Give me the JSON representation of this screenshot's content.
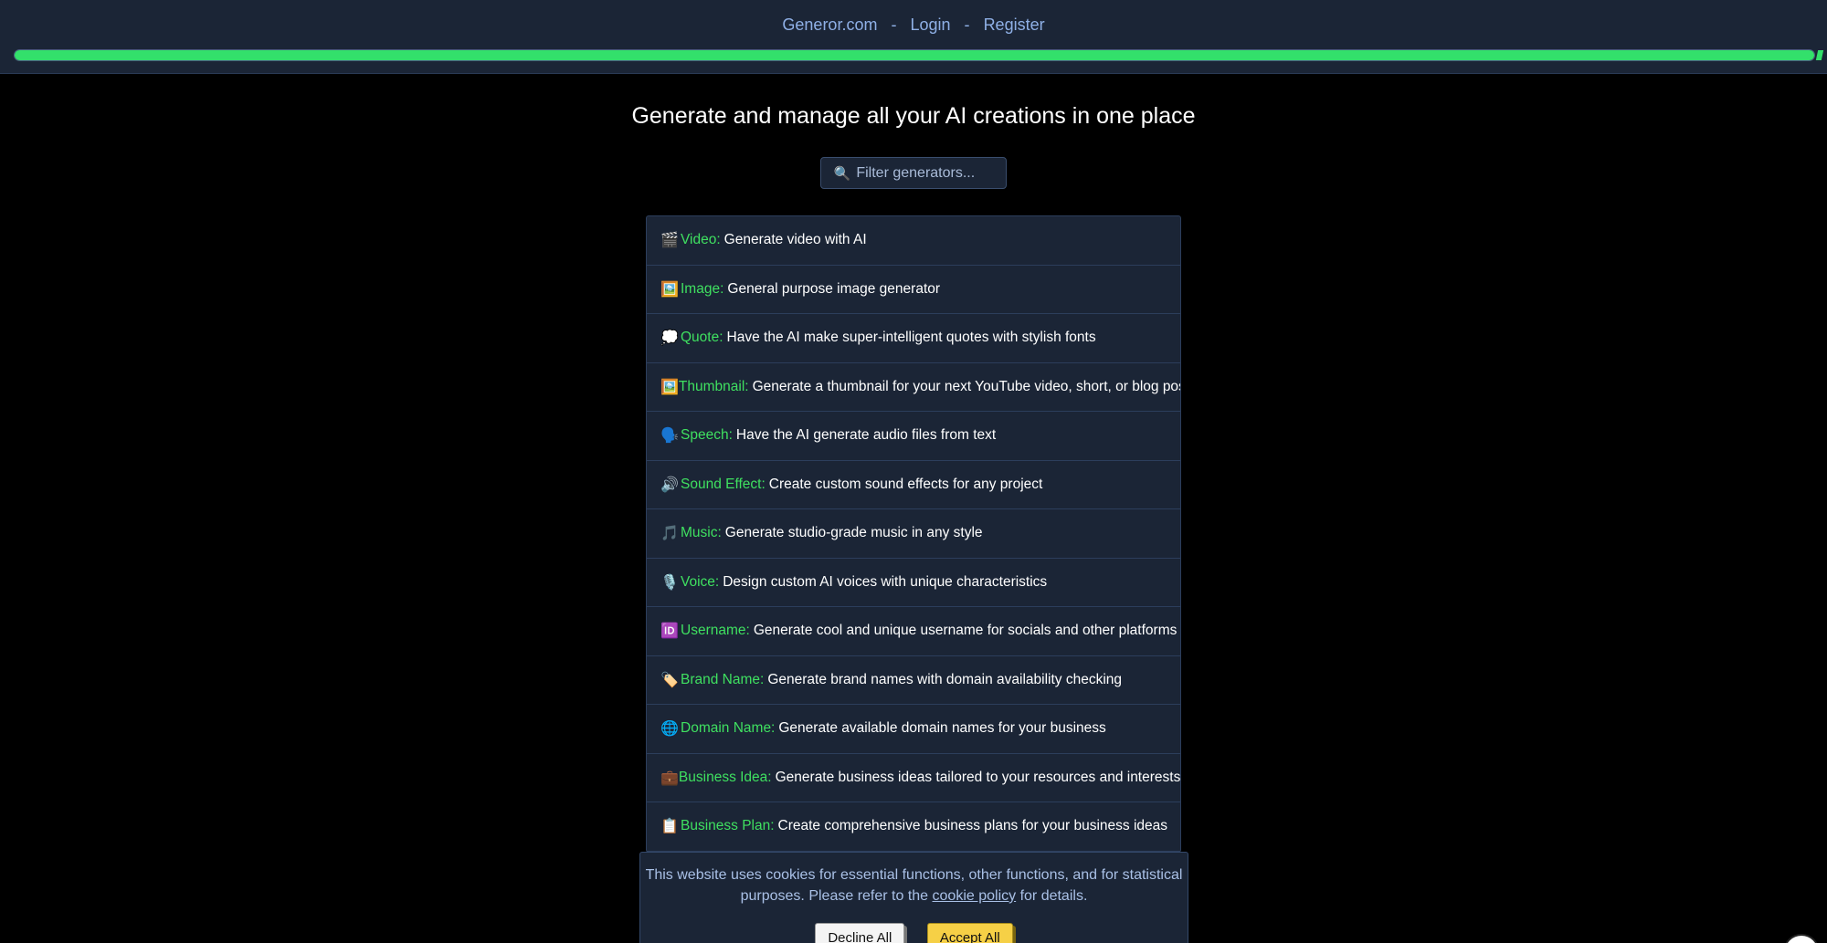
{
  "nav": {
    "site": "Generor.com",
    "login": "Login",
    "register": "Register",
    "separator": "-"
  },
  "progress": {
    "value_percent": 100,
    "color": "#33e06b"
  },
  "headline": "Generate and manage all your AI creations in one place",
  "search": {
    "icon": "🔍",
    "placeholder": "Filter generators..."
  },
  "generators": [
    {
      "emoji": "🎬",
      "name": "Video:",
      "desc": "Generate video with AI"
    },
    {
      "emoji": "🖼️",
      "name": "Image:",
      "desc": "General purpose image generator"
    },
    {
      "emoji": "💭",
      "name": "Quote:",
      "desc": "Have the AI make super-intelligent quotes with stylish fonts"
    },
    {
      "emoji": "🖼️",
      "name": "Thumbnail:",
      "desc": "Generate a thumbnail for your next YouTube video, short, or blog post"
    },
    {
      "emoji": "🗣️",
      "name": "Speech:",
      "desc": "Have the AI generate audio files from text"
    },
    {
      "emoji": "🔊",
      "name": "Sound Effect:",
      "desc": "Create custom sound effects for any project"
    },
    {
      "emoji": "🎵",
      "name": "Music:",
      "desc": "Generate studio-grade music in any style"
    },
    {
      "emoji": "🎙️",
      "name": "Voice:",
      "desc": "Design custom AI voices with unique characteristics"
    },
    {
      "emoji": "🆔",
      "name": "Username:",
      "desc": "Generate cool and unique username for socials and other platforms"
    },
    {
      "emoji": "🏷️",
      "name": "Brand Name:",
      "desc": "Generate brand names with domain availability checking"
    },
    {
      "emoji": "🌐",
      "name": "Domain Name:",
      "desc": "Generate available domain names for your business"
    },
    {
      "emoji": "💼",
      "name": "Business Idea:",
      "desc": "Generate business ideas tailored to your resources and interests"
    },
    {
      "emoji": "📋",
      "name": "Business Plan:",
      "desc": "Create comprehensive business plans for your business ideas"
    }
  ],
  "cookie": {
    "text_before": "This website uses cookies for essential functions, other functions, and for statistical purposes. Please refer to the ",
    "link": "cookie policy",
    "text_after": " for details.",
    "decline": "Decline All",
    "accept": "Accept All"
  }
}
